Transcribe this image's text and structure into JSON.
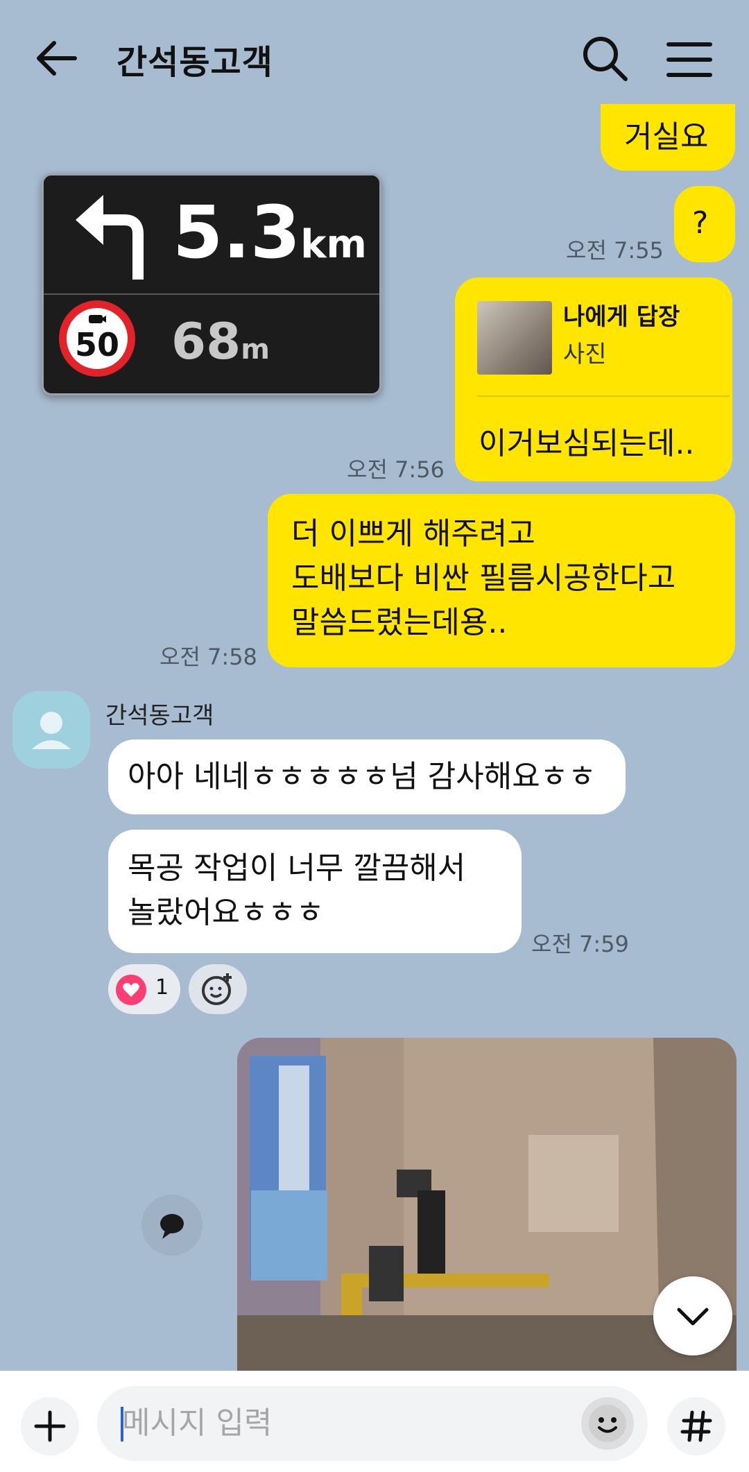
{
  "header": {
    "title": "간석동고객"
  },
  "messages": {
    "m1": {
      "text": "거실요"
    },
    "m2": {
      "text": "?",
      "time": "오전 7:55"
    },
    "m3": {
      "reply_title": "나에게 답장",
      "reply_sub": "사진",
      "text": "이거보심되는데..",
      "time": "오전 7:56"
    },
    "m4": {
      "line1": "더 이쁘게 해주려고",
      "line2": "도배보다 비싼 필름시공한다고",
      "line3": "말씀드렸는데용..",
      "time": "오전 7:58"
    },
    "sender": "간석동고객",
    "m5": {
      "text": "아아 네네ㅎㅎㅎㅎㅎ넘 감사해요ㅎㅎ"
    },
    "m6": {
      "line1": "목공 작업이 너무 깔끔해서",
      "line2": "놀랐어요ㅎㅎㅎ",
      "time": "오전 7:59"
    },
    "reaction": {
      "count": "1"
    }
  },
  "navi": {
    "distance": "5.3",
    "distance_unit": "km",
    "speed_limit": "50",
    "camera_distance": "68",
    "camera_unit": "m"
  },
  "input": {
    "placeholder": "메시지 입력"
  },
  "icons": [
    "back-arrow-icon",
    "search-icon",
    "menu-icon",
    "plus-icon",
    "emoji-icon",
    "hashtag-icon",
    "chevron-down-icon",
    "speech-bubble-icon",
    "heart-icon",
    "add-reaction-icon"
  ],
  "colors": {
    "background": "#a8bcd1",
    "my_bubble": "#ffe500",
    "friend_bubble": "#ffffff"
  }
}
